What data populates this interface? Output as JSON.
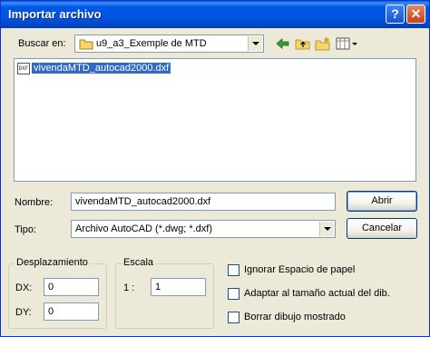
{
  "window": {
    "title": "Importar archivo"
  },
  "titlebar": {
    "help_label": "?",
    "close_label": "✕"
  },
  "lookin": {
    "label": "Buscar en:",
    "value": "u9_a3_Exemple de MTD"
  },
  "files": [
    {
      "name": "vivendaMTD_autocad2000.dxf",
      "icon": "dxf-file-icon",
      "badge": "DXF"
    }
  ],
  "filename": {
    "label": "Nombre:",
    "value": "vivendaMTD_autocad2000.dxf"
  },
  "filetype": {
    "label": "Tipo:",
    "value": "Archivo AutoCAD (*.dwg; *.dxf)"
  },
  "buttons": {
    "open": "Abrir",
    "cancel": "Cancelar"
  },
  "offset": {
    "title": "Desplazamiento",
    "dx_label": "DX:",
    "dx_value": "0",
    "dy_label": "DY:",
    "dy_value": "0"
  },
  "scale": {
    "title": "Escala",
    "label": "1 :",
    "value": "1"
  },
  "options": [
    {
      "label": "Ignorar Espacio de papel",
      "checked": false
    },
    {
      "label": "Adaptar al tamaño actual del dib.",
      "checked": false
    },
    {
      "label": "Borrar dibujo mostrado",
      "checked": false
    }
  ],
  "colors": {
    "titlebar": "#0054e3",
    "selection": "#316ac5",
    "face": "#ece9d8"
  }
}
